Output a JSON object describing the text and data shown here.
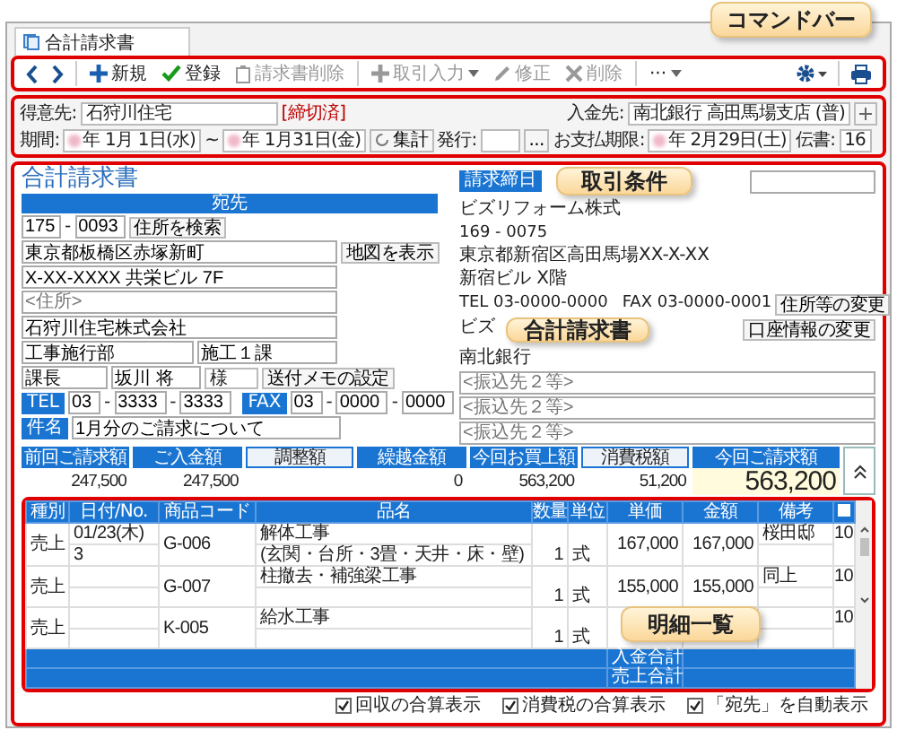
{
  "tab": {
    "label": "合計請求書"
  },
  "toolbar": {
    "actions": [
      {
        "label": "新規",
        "disabled": false,
        "dropdown": false
      },
      {
        "label": "登録",
        "disabled": false,
        "dropdown": false
      },
      {
        "label": "請求書削除",
        "disabled": true,
        "dropdown": false
      },
      {
        "label": "取引入力",
        "disabled": true,
        "dropdown": true
      },
      {
        "label": "修正",
        "disabled": true,
        "dropdown": false
      },
      {
        "label": "削除",
        "disabled": true,
        "dropdown": false
      },
      {
        "label": "···",
        "disabled": false,
        "dropdown": true
      }
    ]
  },
  "conditions": {
    "customer_label": "得意先:",
    "customer": "石狩川住宅",
    "status": "[締切済]",
    "bank_label": "入金先:",
    "bank": "南北銀行 高田馬場支店 (普)",
    "period_label": "期間:",
    "period_from": "年 1月 1日(水)",
    "tilde": "~",
    "period_to": "年 1月31日(金)",
    "tally_button": "集計",
    "issue_label": "発行:",
    "issue_button": "...",
    "due_label": "お支払期限:",
    "due": "年 2月29日(土)",
    "slips_label": "伝書:",
    "slips": "16"
  },
  "invoice": {
    "title": "合計請求書",
    "recipient_header": "宛先",
    "zip1": "175",
    "zip_dash": "-",
    "zip2": "0093",
    "search_button": "住所を検索",
    "address1": "東京都板橋区赤塚新町",
    "map_button": "地図を表示",
    "address2": "X-XX-XXXX 共栄ビル 7F",
    "address3_placeholder": "<住所>",
    "company": "石狩川住宅株式会社",
    "department": "工事施行部",
    "section": "施工１課",
    "position": "課長",
    "person": "坂川 将",
    "honorific": "様",
    "memo_button": "送付メモの設定",
    "tel_label": "TEL",
    "tel": [
      "03",
      "3333",
      "3333"
    ],
    "fax_label": "FAX",
    "fax": [
      "03",
      "0000",
      "0000"
    ],
    "separator": "-",
    "subject_label": "件名",
    "subject": "1月分のご請求について"
  },
  "issuer": {
    "closing_label": "請求締日",
    "name": "ビズリフォーム株式",
    "zip": "169 - 0075",
    "address": "東京都新宿区高田馬場XX-X-XX",
    "building": "新宿ビル X階",
    "tel": "TEL 03-0000-0000",
    "fax": "FAX 03-0000-0001",
    "address_button": "住所等の変更",
    "bank_name_prefix": "ビズ",
    "account_button": "口座情報の変更",
    "bank": "南北銀行",
    "transfer_placeholders": [
      "<振込先２等>",
      "<振込先２等>",
      "<振込先２等>"
    ]
  },
  "summary": [
    {
      "label": "前回ご請求額",
      "value": "247,500",
      "selected": false,
      "kind": "plain"
    },
    {
      "label": "ご入金額",
      "value": "247,500",
      "selected": false,
      "kind": "plain"
    },
    {
      "label": "調整額",
      "selected": true,
      "kind": "plain"
    },
    {
      "label": "繰越金額",
      "value": "0",
      "selected": false,
      "kind": "plain"
    },
    {
      "label": "今回お買上額",
      "value": "563,200",
      "selected": false,
      "kind": "plain"
    },
    {
      "label": "消費税額",
      "value": "51,200",
      "selected": true,
      "kind": "plain"
    },
    {
      "label": "今回ご請求額",
      "value": "563,200",
      "selected": false,
      "kind": "total"
    }
  ],
  "table": {
    "columns": [
      "種別",
      "日付/No.",
      "商品コード",
      "品名",
      "数量",
      "単位",
      "単価",
      "金額",
      "備考"
    ],
    "rows": [
      {
        "type": "売上",
        "date": "01/23(木)",
        "number": "3",
        "code": "G-006",
        "name": "解体工事",
        "name_note": "(玄関・台所・3畳・天井・床・壁)",
        "qty": "1",
        "unit": "式",
        "price": "167,000",
        "amount": "167,000",
        "note": "桜田邸",
        "column_10": "10"
      },
      {
        "type": "売上",
        "code": "G-007",
        "name": "柱撤去・補強梁工事",
        "qty": "1",
        "unit": "式",
        "price": "155,000",
        "amount": "155,000",
        "note": "同上",
        "column_10": "10"
      },
      {
        "type": "売上",
        "code": "K-005",
        "name": "給水工事",
        "qty": "1",
        "unit": "式",
        "column_10": "10"
      }
    ],
    "totals": [
      "入金合計",
      "売上合計"
    ]
  },
  "footer": [
    {
      "label": "回収の合算表示",
      "checked": true
    },
    {
      "label": "消費税の合算表示",
      "checked": true
    },
    {
      "label": "「宛先」を自動表示",
      "checked": true
    }
  ],
  "callouts": [
    "コマンドバー",
    "取引条件",
    "合計請求書",
    "明細一覧"
  ]
}
